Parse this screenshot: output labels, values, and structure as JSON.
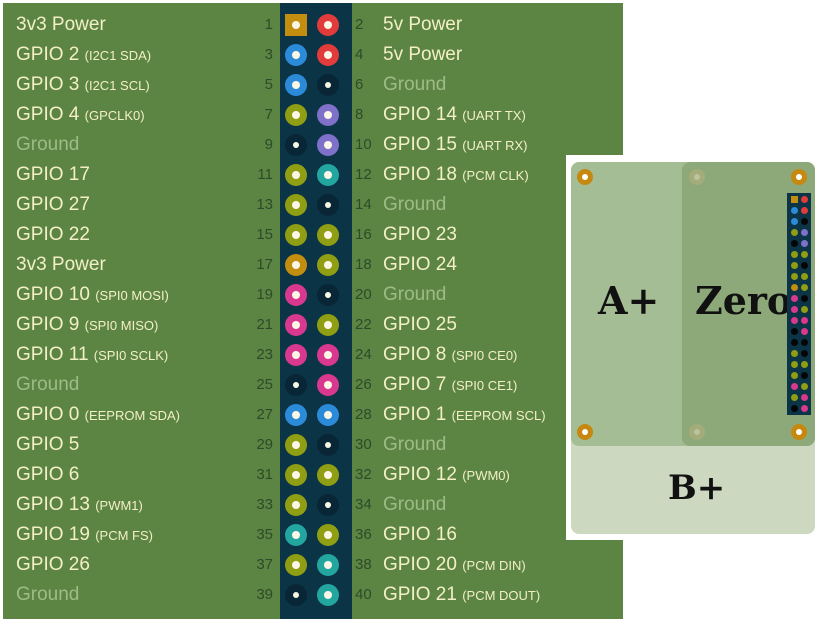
{
  "colors": {
    "power3v3": "#c38d0f",
    "power5v": "#e23b3b",
    "i2c": "#2c8bd9",
    "gpio": "#8f9e12",
    "uart": "#7f70c9",
    "spi": "#d9388f",
    "pcm": "#23a5a0",
    "ground": "#082635"
  },
  "pins": [
    {
      "num": "1",
      "label": "3v3 Power",
      "sub": "",
      "type": "power3v3",
      "side": "left",
      "shape": "square"
    },
    {
      "num": "2",
      "label": "5v Power",
      "sub": "",
      "type": "power5v",
      "side": "right"
    },
    {
      "num": "3",
      "label": "GPIO 2",
      "sub": "(I2C1 SDA)",
      "type": "i2c",
      "side": "left"
    },
    {
      "num": "4",
      "label": "5v Power",
      "sub": "",
      "type": "power5v",
      "side": "right"
    },
    {
      "num": "5",
      "label": "GPIO 3",
      "sub": "(I2C1 SCL)",
      "type": "i2c",
      "side": "left"
    },
    {
      "num": "6",
      "label": "Ground",
      "sub": "",
      "type": "ground",
      "side": "right"
    },
    {
      "num": "7",
      "label": "GPIO 4",
      "sub": "(GPCLK0)",
      "type": "gpio",
      "side": "left"
    },
    {
      "num": "8",
      "label": "GPIO 14",
      "sub": "(UART TX)",
      "type": "uart",
      "side": "right"
    },
    {
      "num": "9",
      "label": "Ground",
      "sub": "",
      "type": "ground",
      "side": "left"
    },
    {
      "num": "10",
      "label": "GPIO 15",
      "sub": "(UART RX)",
      "type": "uart",
      "side": "right"
    },
    {
      "num": "11",
      "label": "GPIO 17",
      "sub": "",
      "type": "gpio",
      "side": "left"
    },
    {
      "num": "12",
      "label": "GPIO 18",
      "sub": "(PCM CLK)",
      "type": "pcm",
      "side": "right"
    },
    {
      "num": "13",
      "label": "GPIO 27",
      "sub": "",
      "type": "gpio",
      "side": "left"
    },
    {
      "num": "14",
      "label": "Ground",
      "sub": "",
      "type": "ground",
      "side": "right"
    },
    {
      "num": "15",
      "label": "GPIO 22",
      "sub": "",
      "type": "gpio",
      "side": "left"
    },
    {
      "num": "16",
      "label": "GPIO 23",
      "sub": "",
      "type": "gpio",
      "side": "right"
    },
    {
      "num": "17",
      "label": "3v3 Power",
      "sub": "",
      "type": "power3v3",
      "side": "left"
    },
    {
      "num": "18",
      "label": "GPIO 24",
      "sub": "",
      "type": "gpio",
      "side": "right"
    },
    {
      "num": "19",
      "label": "GPIO 10",
      "sub": "(SPI0 MOSI)",
      "type": "spi",
      "side": "left"
    },
    {
      "num": "20",
      "label": "Ground",
      "sub": "",
      "type": "ground",
      "side": "right"
    },
    {
      "num": "21",
      "label": "GPIO 9",
      "sub": "(SPI0 MISO)",
      "type": "spi",
      "side": "left"
    },
    {
      "num": "22",
      "label": "GPIO 25",
      "sub": "",
      "type": "gpio",
      "side": "right"
    },
    {
      "num": "23",
      "label": "GPIO 11",
      "sub": "(SPI0 SCLK)",
      "type": "spi",
      "side": "left"
    },
    {
      "num": "24",
      "label": "GPIO 8",
      "sub": "(SPI0 CE0)",
      "type": "spi",
      "side": "right"
    },
    {
      "num": "25",
      "label": "Ground",
      "sub": "",
      "type": "ground",
      "side": "left"
    },
    {
      "num": "26",
      "label": "GPIO 7",
      "sub": "(SPI0 CE1)",
      "type": "spi",
      "side": "right"
    },
    {
      "num": "27",
      "label": "GPIO 0",
      "sub": "(EEPROM SDA)",
      "type": "i2c",
      "side": "left"
    },
    {
      "num": "28",
      "label": "GPIO 1",
      "sub": "(EEPROM SCL)",
      "type": "i2c",
      "side": "right"
    },
    {
      "num": "29",
      "label": "GPIO 5",
      "sub": "",
      "type": "gpio",
      "side": "left"
    },
    {
      "num": "30",
      "label": "Ground",
      "sub": "",
      "type": "ground",
      "side": "right"
    },
    {
      "num": "31",
      "label": "GPIO 6",
      "sub": "",
      "type": "gpio",
      "side": "left"
    },
    {
      "num": "32",
      "label": "GPIO 12",
      "sub": "(PWM0)",
      "type": "gpio",
      "side": "right"
    },
    {
      "num": "33",
      "label": "GPIO 13",
      "sub": "(PWM1)",
      "type": "gpio",
      "side": "left"
    },
    {
      "num": "34",
      "label": "Ground",
      "sub": "",
      "type": "ground",
      "side": "right"
    },
    {
      "num": "35",
      "label": "GPIO 19",
      "sub": "(PCM FS)",
      "type": "pcm",
      "side": "left"
    },
    {
      "num": "36",
      "label": "GPIO 16",
      "sub": "",
      "type": "gpio",
      "side": "right"
    },
    {
      "num": "37",
      "label": "GPIO 26",
      "sub": "",
      "type": "gpio",
      "side": "left"
    },
    {
      "num": "38",
      "label": "GPIO 20",
      "sub": "(PCM DIN)",
      "type": "pcm",
      "side": "right"
    },
    {
      "num": "39",
      "label": "Ground",
      "sub": "",
      "type": "ground",
      "side": "left"
    },
    {
      "num": "40",
      "label": "GPIO 21",
      "sub": "(PCM DOUT)",
      "type": "pcm",
      "side": "right"
    }
  ],
  "board": {
    "labels": {
      "aplus": "A+",
      "zero": "Zero",
      "bplus": "B+"
    },
    "colors": {
      "bplus": "#ccd8c0",
      "aplus": "#a5bd94",
      "zero": "#8ea979",
      "hole": "#c6880f"
    },
    "mini_header": [
      [
        "power3v3",
        "power5v"
      ],
      [
        "i2c",
        "power5v"
      ],
      [
        "i2c",
        "ground"
      ],
      [
        "gpio",
        "uart"
      ],
      [
        "ground",
        "uart"
      ],
      [
        "gpio",
        "gpio"
      ],
      [
        "gpio",
        "ground"
      ],
      [
        "gpio",
        "gpio"
      ],
      [
        "power3v3",
        "gpio"
      ],
      [
        "spi",
        "ground"
      ],
      [
        "spi",
        "gpio"
      ],
      [
        "spi",
        "spi"
      ],
      [
        "ground",
        "spi"
      ],
      [
        "ground",
        "ground"
      ],
      [
        "gpio",
        "ground"
      ],
      [
        "gpio",
        "gpio"
      ],
      [
        "gpio",
        "ground"
      ],
      [
        "spi",
        "gpio"
      ],
      [
        "gpio",
        "spi"
      ],
      [
        "ground",
        "spi"
      ]
    ]
  }
}
